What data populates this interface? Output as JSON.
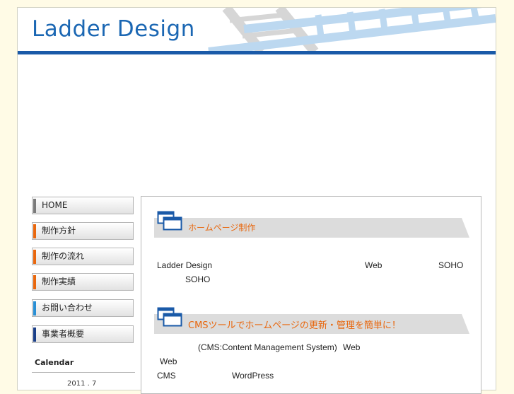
{
  "header": {
    "logo": "Ladder Design"
  },
  "nav": {
    "items": [
      {
        "label": "HOME",
        "accent": "#7a7a7a"
      },
      {
        "label": "制作方針",
        "accent": "#e8670e"
      },
      {
        "label": "制作の流れ",
        "accent": "#e8670e"
      },
      {
        "label": "制作実績",
        "accent": "#e8670e"
      },
      {
        "label": "お問い合わせ",
        "accent": "#2a8fd4"
      },
      {
        "label": "事業者概要",
        "accent": "#1b3f88"
      }
    ]
  },
  "calendar": {
    "title": "Calendar",
    "month": "2011 . 7"
  },
  "sections": [
    {
      "title": "ホームページ制作",
      "lines": [
        [
          "Ladder Design",
          "Web",
          "SOHO"
        ],
        [
          "SOHO"
        ]
      ]
    },
    {
      "title": "CMSツールでホームページの更新・管理を簡単に！",
      "lines": [
        [
          "(CMS:Content Management System)",
          "Web"
        ],
        [
          "Web"
        ],
        [
          "CMS",
          "WordPress"
        ]
      ]
    }
  ],
  "colors": {
    "brand": "#1b67b3",
    "accent": "#e8670e",
    "bar": "#1a5aa8"
  }
}
